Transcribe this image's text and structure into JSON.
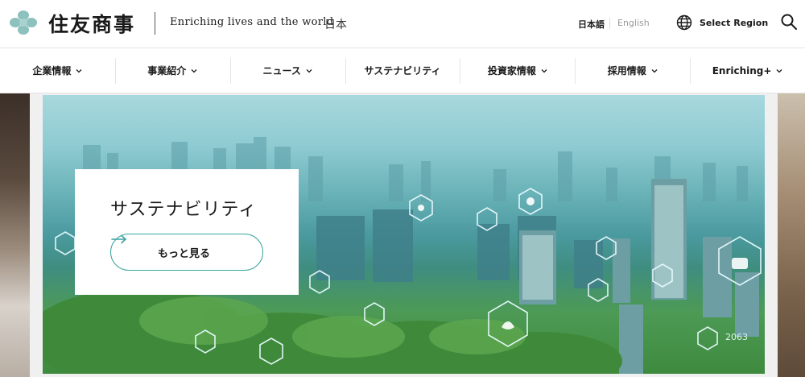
{
  "header": {
    "brand": "住友商事",
    "tagline": "Enriching lives and the world",
    "country": "日本",
    "lang_japanese": "日本語",
    "lang_english": "English",
    "select_region": "Select Region"
  },
  "nav": {
    "items": [
      {
        "label": "企業情報",
        "has_dropdown": true
      },
      {
        "label": "事業紹介",
        "has_dropdown": true
      },
      {
        "label": "ニュース",
        "has_dropdown": true
      },
      {
        "label": "サステナビリティ",
        "has_dropdown": false
      },
      {
        "label": "投資家情報",
        "has_dropdown": true
      },
      {
        "label": "採用情報",
        "has_dropdown": true
      },
      {
        "label": "Enriching+",
        "has_dropdown": true
      }
    ]
  },
  "hero": {
    "title": "サステナビリティ",
    "button_label": "もっと見る",
    "image_caption": "2063"
  },
  "colors": {
    "accent": "#3aa3a0",
    "brand_logo": "#7fb8b4",
    "text": "#1a1a1a"
  },
  "icons": [
    "logo-mark-icon",
    "globe-icon",
    "search-icon",
    "chevron-down-icon",
    "arrow-right-icon"
  ]
}
